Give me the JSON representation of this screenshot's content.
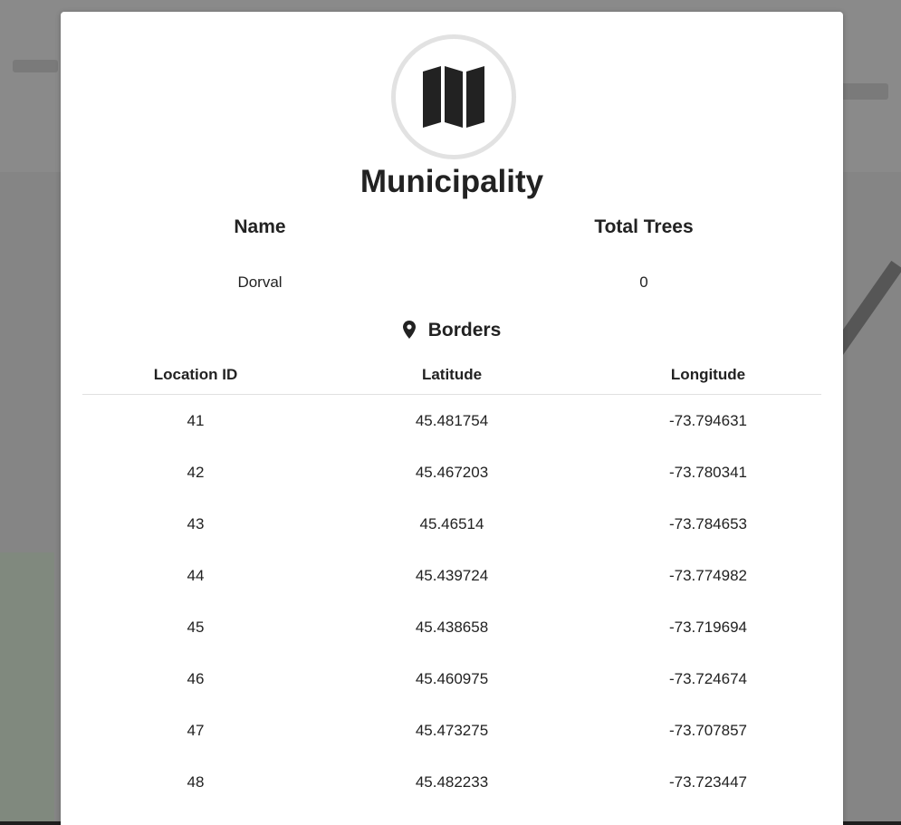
{
  "modal": {
    "icon": "map-icon",
    "title": "Municipality",
    "info": {
      "name_header": "Name",
      "name_value": "Dorval",
      "trees_header": "Total Trees",
      "trees_value": "0"
    },
    "borders": {
      "icon": "map-marker-icon",
      "heading": "Borders",
      "columns": [
        "Location ID",
        "Latitude",
        "Longitude"
      ],
      "rows": [
        [
          "41",
          "45.481754",
          "-73.794631"
        ],
        [
          "42",
          "45.467203",
          "-73.780341"
        ],
        [
          "43",
          "45.46514",
          "-73.784653"
        ],
        [
          "44",
          "45.439724",
          "-73.774982"
        ],
        [
          "45",
          "45.438658",
          "-73.719694"
        ],
        [
          "46",
          "45.460975",
          "-73.724674"
        ],
        [
          "47",
          "45.473275",
          "-73.707857"
        ],
        [
          "48",
          "45.482233",
          "-73.723447"
        ]
      ]
    }
  },
  "colors": {
    "text": "#222222",
    "icon_ring": "#e2e2e2",
    "backdrop": "#7f7f7f",
    "divider": "#e0e0e0"
  }
}
